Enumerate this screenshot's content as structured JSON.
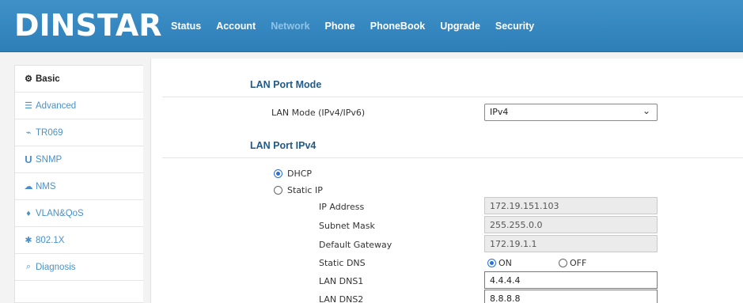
{
  "brand": {
    "logo": "DINSTAR"
  },
  "nav": {
    "items": [
      {
        "label": "Status"
      },
      {
        "label": "Account"
      },
      {
        "label": "Network",
        "active": true
      },
      {
        "label": "Phone"
      },
      {
        "label": "PhoneBook"
      },
      {
        "label": "Upgrade"
      },
      {
        "label": "Security"
      }
    ]
  },
  "sidebar": {
    "items": [
      {
        "label": "Basic",
        "icon": "basic-icon",
        "glyph": "⚙",
        "active": true
      },
      {
        "label": "Advanced",
        "icon": "list-icon",
        "glyph": "☰"
      },
      {
        "label": "TR069",
        "icon": "link-icon",
        "glyph": "⌁"
      },
      {
        "label": "SNMP",
        "icon": "snmp-icon",
        "glyph": "U"
      },
      {
        "label": "NMS",
        "icon": "cloud-icon",
        "glyph": "☁"
      },
      {
        "label": "VLAN&QoS",
        "icon": "pin-icon",
        "glyph": "♦"
      },
      {
        "label": "802.1X",
        "icon": "asterisk-icon",
        "glyph": "✱"
      },
      {
        "label": "Diagnosis",
        "icon": "search-icon",
        "glyph": "⌕"
      }
    ]
  },
  "main": {
    "lan_port_mode": {
      "title": "LAN Port Mode",
      "mode_label": "LAN Mode (IPv4/IPv6)",
      "mode_value": "IPv4"
    },
    "lan_port_ipv4": {
      "title": "LAN Port IPv4",
      "dhcp_label": "DHCP",
      "static_label": "Static IP",
      "selected": "DHCP",
      "ip_address_label": "IP Address",
      "ip_address": "172.19.151.103",
      "subnet_mask_label": "Subnet Mask",
      "subnet_mask": "255.255.0.0",
      "gateway_label": "Default Gateway",
      "gateway": "172.19.1.1",
      "static_dns_label": "Static DNS",
      "dns_on_label": "ON",
      "dns_off_label": "OFF",
      "static_dns_selected": "ON",
      "dns1_label": "LAN DNS1",
      "dns1": "4.4.4.4",
      "dns2_label": "LAN DNS2",
      "dns2": "8.8.8.8"
    }
  },
  "colors": {
    "header": "#3588c0",
    "accent": "#1f5a8a",
    "link": "#4a90c8"
  }
}
